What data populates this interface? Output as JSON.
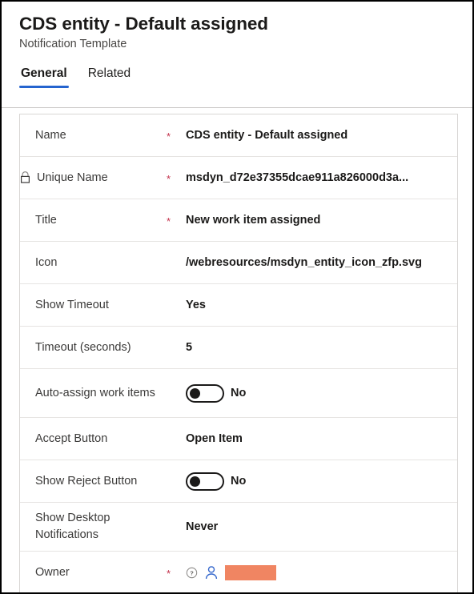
{
  "header": {
    "title": "CDS entity - Default assigned",
    "subtitle": "Notification Template",
    "tabs": [
      {
        "label": "General",
        "active": true
      },
      {
        "label": "Related",
        "active": false
      }
    ]
  },
  "theme": {
    "accent": "#2564cf",
    "required_asterisk": "#c4314b",
    "redaction": "#f08562",
    "person_icon": "#3366cc",
    "text_primary": "#1b1a19",
    "label": "#3b3a39",
    "row_divider": "#e6e4e2"
  },
  "form": {
    "rows": [
      {
        "label": "Name",
        "required": "*",
        "type": "text",
        "value": "CDS entity - Default assigned",
        "locked": false
      },
      {
        "label": "Unique Name",
        "required": "*",
        "type": "text",
        "value": "msdyn_d72e37355dcae911a826000d3a...",
        "locked": true
      },
      {
        "label": "Title",
        "required": "*",
        "type": "text",
        "value": "New work item assigned",
        "locked": false
      },
      {
        "label": "Icon",
        "required": "",
        "type": "text",
        "value": "/webresources/msdyn_entity_icon_zfp.svg",
        "locked": false
      },
      {
        "label": "Show Timeout",
        "required": "",
        "type": "text",
        "value": "Yes",
        "locked": false
      },
      {
        "label": "Timeout (seconds)",
        "required": "",
        "type": "text",
        "value": "5",
        "locked": false
      },
      {
        "label": "Auto-assign work items",
        "required": "",
        "type": "toggle",
        "value": "No",
        "toggle_on": false,
        "locked": false
      },
      {
        "label": "Accept Button",
        "required": "",
        "type": "text",
        "value": "Open Item",
        "locked": false
      },
      {
        "label": "Show Reject Button",
        "required": "",
        "type": "toggle",
        "value": "No",
        "toggle_on": false,
        "locked": false
      },
      {
        "label": "Show Desktop Notifications",
        "required": "",
        "type": "text",
        "value": "Never",
        "locked": false
      },
      {
        "label": "Owner",
        "required": "*",
        "type": "owner",
        "value": "",
        "locked": false
      }
    ]
  },
  "icons": {
    "lock": "lock-icon",
    "help": "help-circle-icon",
    "person": "person-icon"
  }
}
